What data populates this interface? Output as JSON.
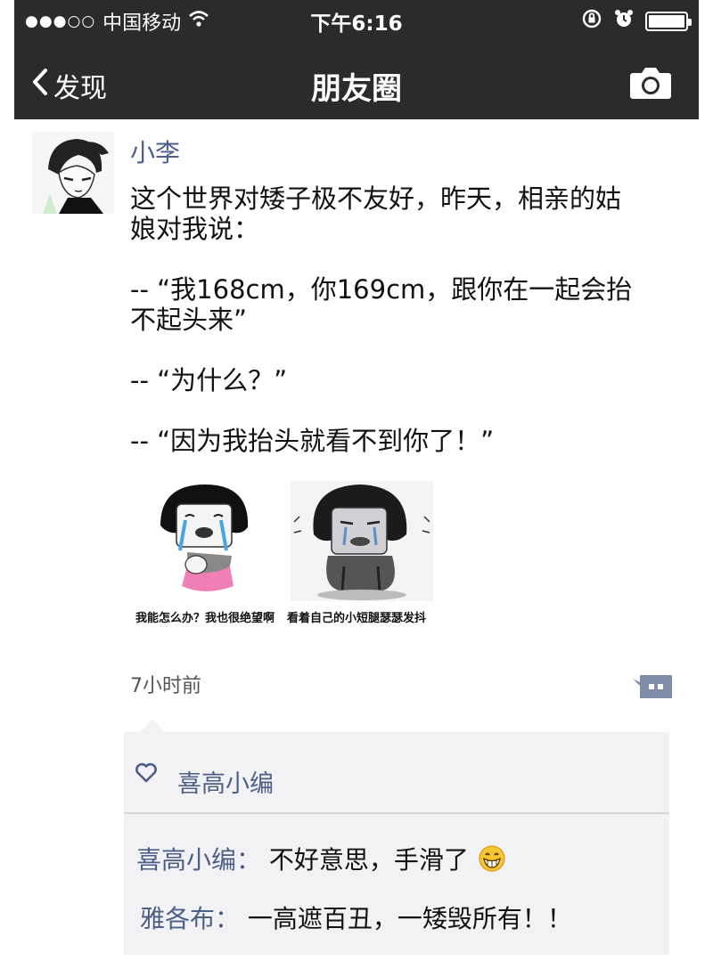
{
  "status_bar": {
    "signal": "●●●○○",
    "carrier": "中国移动",
    "time": "下午6:16"
  },
  "nav": {
    "back_label": "发现",
    "title": "朋友圈"
  },
  "post": {
    "author": "小李",
    "text": "这个世界对矮子极不友好，昨天，相亲的姑\n娘对我说：\n\n-- “我168cm，你169cm，跟你在一起会抬\n不起头来”\n\n-- “为什么？”\n\n-- “因为我抬头就看不到你了！”",
    "image_captions": [
      "我能怎么办？我也很绝望啊",
      "看着自己的小短腿瑟瑟发抖"
    ],
    "time_ago": "7小时前"
  },
  "likes": {
    "names": "喜高小编"
  },
  "comments": [
    {
      "author": "喜高小编：",
      "text": "不好意思，手滑了"
    },
    {
      "author": "雅各布：",
      "text": "一高遮百丑，一矮毁所有！！"
    }
  ],
  "icons": {
    "back": "chevron-left-icon",
    "camera": "camera-icon",
    "wifi": "wifi-icon",
    "lock_rotation": "lock-rotation-icon",
    "alarm": "alarm-icon",
    "battery": "battery-icon",
    "comment": "comment-bubble-icon",
    "heart": "heart-icon",
    "grin": "grin-emoji-icon"
  },
  "colors": {
    "nav_bg": "#2b2b2d",
    "name_blue": "#4b5f89",
    "panel_bg": "#f2f2f4"
  }
}
